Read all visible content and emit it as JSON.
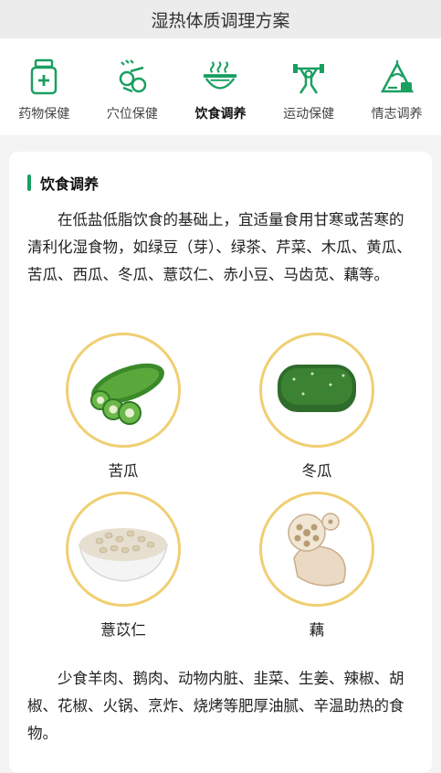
{
  "header": {
    "title": "湿热体质调理方案"
  },
  "tabs": [
    {
      "label": "药物保健",
      "icon": "medicine-bottle-icon",
      "active": false
    },
    {
      "label": "穴位保健",
      "icon": "acupoint-icon",
      "active": false
    },
    {
      "label": "饮食调养",
      "icon": "food-bowl-icon",
      "active": true
    },
    {
      "label": "运动保健",
      "icon": "exercise-icon",
      "active": false
    },
    {
      "label": "情志调养",
      "icon": "emotion-icon",
      "active": false
    }
  ],
  "section": {
    "title": "饮食调养",
    "intro": "在低盐低脂饮食的基础上，宜适量食用甘寒或苦寒的清利化湿食物，如绿豆（芽）、绿茶、芹菜、木瓜、黄瓜、苦瓜、西瓜、冬瓜、薏苡仁、赤小豆、马齿苋、藕等。",
    "foods": [
      {
        "name": "苦瓜",
        "image": "bitter-melon"
      },
      {
        "name": "冬瓜",
        "image": "winter-melon"
      },
      {
        "name": "薏苡仁",
        "image": "coix-seed"
      },
      {
        "name": "藕",
        "image": "lotus-root"
      }
    ],
    "advice": "少食羊肉、鹅肉、动物内脏、韭菜、生姜、辣椒、胡椒、花椒、火锅、烹炸、烧烤等肥厚油腻、辛温助热的食物。"
  },
  "colors": {
    "accent": "#1a9f61",
    "ring": "#f0cf72"
  }
}
